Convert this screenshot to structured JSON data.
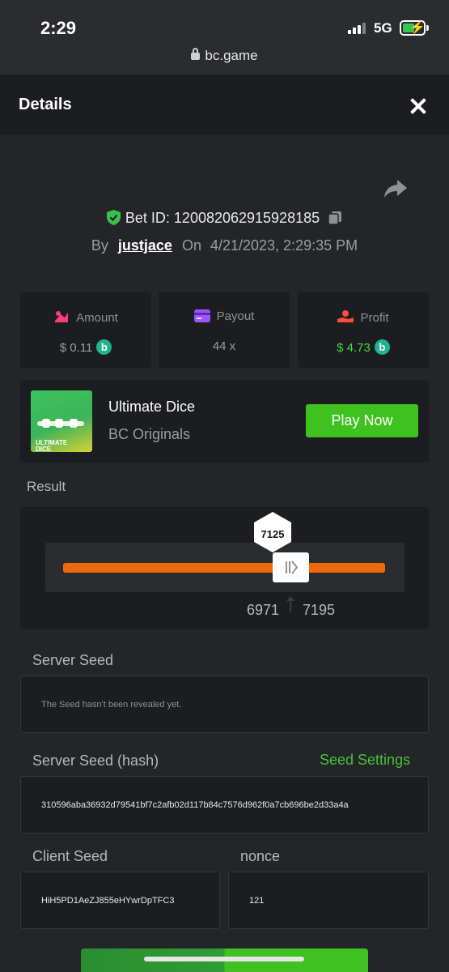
{
  "status_bar": {
    "time": "2:29",
    "network": "5G"
  },
  "browser": {
    "url": "bc.game"
  },
  "header": {
    "title": "Details"
  },
  "bet": {
    "bet_id_label": "Bet ID:",
    "bet_id": "120082062915928185",
    "by_label": "By",
    "username": "justjace",
    "on_label": "On",
    "datetime": "4/21/2023, 2:29:35 PM"
  },
  "stats": {
    "amount": {
      "label": "Amount",
      "value": "$ 0.11"
    },
    "payout": {
      "label": "Payout",
      "value": "44 x"
    },
    "profit": {
      "label": "Profit",
      "value": "$ 4.73"
    }
  },
  "game": {
    "name": "Ultimate Dice",
    "provider": "BC Originals",
    "play_label": "Play Now",
    "thumb_text_line1": "ULTIMATE",
    "thumb_text_line2": "DICE"
  },
  "result": {
    "title": "Result",
    "value": "7125",
    "range_low": "6971",
    "range_high": "7195"
  },
  "seeds": {
    "server_seed_label": "Server Seed",
    "server_seed_value": "The Seed hasn't been revealed yet.",
    "server_hash_label": "Server Seed (hash)",
    "seed_settings_label": "Seed Settings",
    "server_hash_value": "310596aba36932d79541bf7c2afb02d117b84c7576d962f0a7cb696be2d33a4a",
    "client_seed_label": "Client Seed",
    "client_seed_value": "HiH5PD1AeZJ855eHYwrDpTFC3",
    "nonce_label": "nonce",
    "nonce_value": "121"
  },
  "colors": {
    "accent_green": "#3fc21f",
    "profit_green": "#47d63f",
    "result_bar_orange": "#ed6a0a",
    "background": "#232528",
    "card": "#1b1d20"
  },
  "icons": [
    "lock-icon",
    "close-icon",
    "share-icon",
    "shield-check-icon",
    "copy-icon",
    "amount-icon",
    "payout-card-icon",
    "profit-icon",
    "bc-coin-icon",
    "slider-grip-icon",
    "up-arrow-icon"
  ]
}
